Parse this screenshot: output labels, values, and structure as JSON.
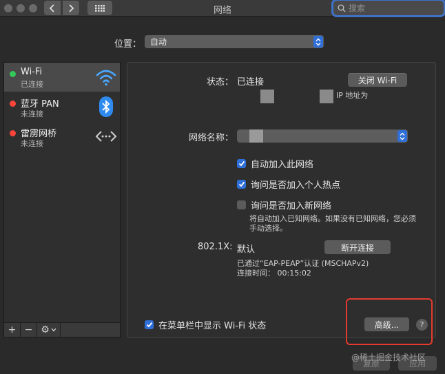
{
  "window": {
    "title": "网络"
  },
  "search": {
    "placeholder": "搜索"
  },
  "location": {
    "label": "位置：",
    "value": "自动"
  },
  "services": [
    {
      "name": "Wi-Fi",
      "status": "已连接",
      "dot_color": "#34c759",
      "icon": "wifi-icon"
    },
    {
      "name": "蓝牙 PAN",
      "status": "未连接",
      "dot_color": "#ff453a",
      "icon": "bluetooth-icon"
    },
    {
      "name": "雷雳网桥",
      "status": "未连接",
      "dot_color": "#ff453a",
      "icon": "thunderbolt-bridge-icon"
    }
  ],
  "list_toolbar": {
    "add": "+",
    "remove": "−",
    "gear": "⚙"
  },
  "detail": {
    "status_label": "状态：",
    "status_value": "已连接",
    "turn_off_button": "关闭 Wi-Fi",
    "ip_text": "IP 地址为",
    "network_name_label": "网络名称：",
    "checkboxes": [
      {
        "label": "自动加入此网络",
        "checked": true
      },
      {
        "label": "询问是否加入个人热点",
        "checked": true
      },
      {
        "label": "询问是否加入新网络",
        "checked": false
      }
    ],
    "note_line1": "将自动加入已知网络。如果没有已知网络，您必须",
    "note_line2": "手动选择。",
    "dot1x_label": "802.1X:",
    "dot1x_value": "默认",
    "disconnect_button": "断开连接",
    "auth_text": "已通过“EAP-PEAP”认证 (MSCHAPv2)",
    "connect_time": "连接时间：  00:15:02",
    "show_in_menubar": {
      "label": "在菜单栏中显示 Wi-Fi 状态",
      "checked": true
    },
    "advanced_button": "高级...",
    "help_button": "?"
  },
  "footer": {
    "revert": "复原",
    "apply": "应用",
    "watermark": "@稀土掘金技术社区"
  },
  "colors": {
    "accent": "#2f6fd9",
    "highlight": "#e53a2e"
  }
}
